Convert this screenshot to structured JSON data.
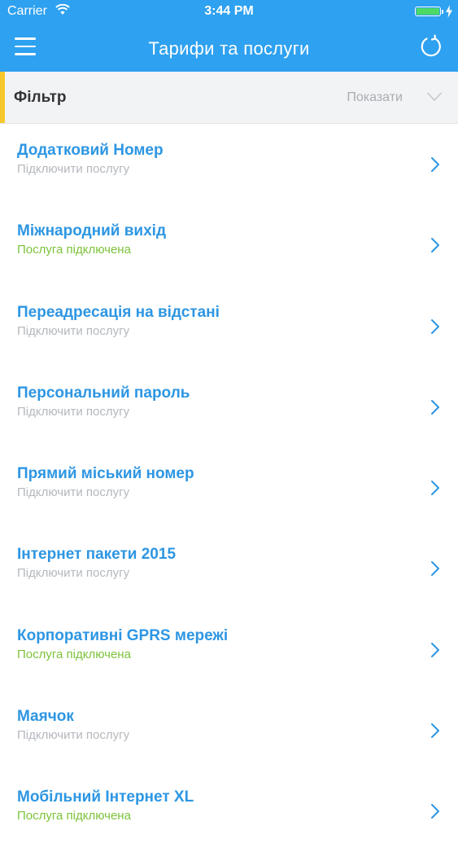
{
  "status_bar": {
    "carrier": "Carrier",
    "time": "3:44 PM",
    "wifi_icon": "wifi-icon",
    "battery_icon": "battery-icon",
    "battery_level": 1.0
  },
  "nav": {
    "title": "Тарифи та послуги",
    "menu_icon": "hamburger-menu-icon",
    "refresh_icon": "refresh-icon"
  },
  "filter": {
    "label": "Фільтр",
    "show_label": "Показати",
    "chevron_icon": "chevron-down-icon"
  },
  "colors": {
    "header_blue": "#2ea1f0",
    "title_blue": "#2d96e3",
    "connected_green": "#7dc33b",
    "inactive_gray": "#b4b8bd",
    "filter_accent": "#f7c82d"
  },
  "services": [
    {
      "title": "Додатковий Номер",
      "status": "Підключити послугу",
      "connected": false
    },
    {
      "title": "Міжнародний вихід",
      "status": "Послуга підключена",
      "connected": true
    },
    {
      "title": "Переадресація на відстані",
      "status": "Підключити послугу",
      "connected": false
    },
    {
      "title": "Персональний пароль",
      "status": "Підключити послугу",
      "connected": false
    },
    {
      "title": "Прямий міський номер",
      "status": "Підключити послугу",
      "connected": false
    },
    {
      "title": "Інтернет пакети 2015",
      "status": "Підключити послугу",
      "connected": false
    },
    {
      "title": "Корпоративні GPRS мережі",
      "status": "Послуга підключена",
      "connected": true
    },
    {
      "title": "Маячок",
      "status": "Підключити послугу",
      "connected": false
    },
    {
      "title": "Мобільний Інтернет XL",
      "status": "Послуга підключена",
      "connected": true
    }
  ]
}
